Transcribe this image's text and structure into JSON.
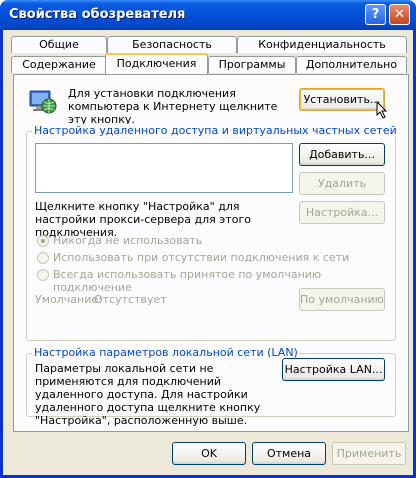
{
  "window": {
    "title": "Свойства обозревателя",
    "help_label": "?",
    "close_label": "✕"
  },
  "tabs": {
    "row1": [
      "Общие",
      "Безопасность",
      "Конфиденциальность"
    ],
    "row2": [
      "Содержание",
      "Подключения",
      "Программы",
      "Дополнительно"
    ],
    "active": "Подключения"
  },
  "setup": {
    "text": "Для установки подключения компьютера к Интернету щелкните эту кнопку.",
    "button": "Установить..."
  },
  "dialup": {
    "group_label": "Настройка удаленного доступа и виртуальных частных сетей",
    "add_button": "Добавить...",
    "remove_button": "Удалить",
    "settings_button": "Настройка...",
    "proxy_text": "Щелкните кнопку \"Настройка\" для настройки прокси-сервера для этого подключения.",
    "options": [
      "Никогда не использовать",
      "Использовать при отсутствии подключения к сети",
      "Всегда использовать принятое по умолчанию подключение"
    ],
    "selected_option": 0,
    "default_label": "Умолчание:",
    "default_value": "Отсутствует",
    "default_button": "По умолчанию"
  },
  "lan": {
    "group_label": "Настройка параметров локальной сети (LAN)",
    "text": "Параметры локальной сети не применяются для подключений удаленного доступа. Для настройки удаленного доступа щелкните кнопку \"Настройка\", расположенную выше.",
    "button": "Настройка LAN..."
  },
  "footer": {
    "ok": "OK",
    "cancel": "Отмена",
    "apply": "Применить"
  }
}
